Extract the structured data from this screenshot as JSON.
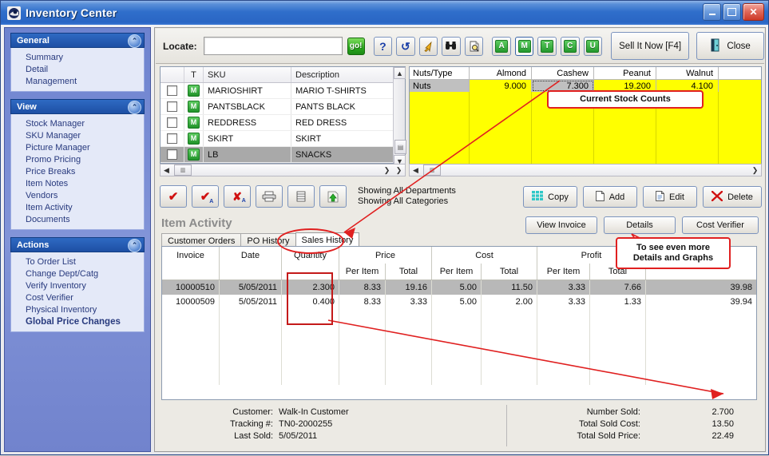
{
  "window": {
    "title": "Inventory Center",
    "minimize": "_",
    "maximize": "❐",
    "close": "✕"
  },
  "sidebar": {
    "groups": [
      {
        "title": "General",
        "collapse_icon": "chevron-up",
        "items": [
          {
            "label": "Summary",
            "bold": false
          },
          {
            "label": "Detail",
            "bold": false
          },
          {
            "label": "Management",
            "bold": false
          }
        ]
      },
      {
        "title": "View",
        "collapse_icon": "chevron-up",
        "items": [
          {
            "label": "Stock Manager",
            "bold": false
          },
          {
            "label": "SKU Manager",
            "bold": false
          },
          {
            "label": "Picture Manager",
            "bold": false
          },
          {
            "label": "Promo Pricing",
            "bold": false
          },
          {
            "label": "Price Breaks",
            "bold": false
          },
          {
            "label": "Item Notes",
            "bold": false
          },
          {
            "label": "Vendors",
            "bold": false
          },
          {
            "label": "Item Activity",
            "bold": false
          },
          {
            "label": "Documents",
            "bold": false
          }
        ]
      },
      {
        "title": "Actions",
        "collapse_icon": "chevron-up",
        "items": [
          {
            "label": "To Order List",
            "bold": false
          },
          {
            "label": "Change Dept/Catg",
            "bold": false
          },
          {
            "label": "Verify Inventory",
            "bold": false
          },
          {
            "label": "Cost Verifier",
            "bold": false
          },
          {
            "label": "Physical Inventory",
            "bold": false
          },
          {
            "label": "Global Price Changes",
            "bold": true
          }
        ]
      }
    ]
  },
  "toolbar": {
    "locate_label": "Locate:",
    "locate_value": "",
    "locate_placeholder": "",
    "go_label": "go!",
    "icon_buttons": [
      {
        "name": "help-icon",
        "glyph": "?"
      },
      {
        "name": "refresh-icon",
        "glyph": "↺"
      },
      {
        "name": "export-arrow-icon",
        "glyph": "↖"
      },
      {
        "name": "binoculars-icon",
        "glyph": "🔭"
      },
      {
        "name": "preview-icon",
        "glyph": "🔍"
      }
    ],
    "letter_buttons": [
      "A",
      "M",
      "T",
      "C",
      "U"
    ],
    "sell_now_label": "Sell It Now [F4]",
    "close_label": "Close",
    "close_icon": "exit-door-icon"
  },
  "item_grid": {
    "columns": [
      "",
      "T",
      "SKU",
      "Description"
    ],
    "rows": [
      {
        "checked": false,
        "type": "M",
        "sku": "MARIOSHIRT",
        "description": "MARIO T-SHIRTS",
        "selected": false
      },
      {
        "checked": false,
        "type": "M",
        "sku": "PANTSBLACK",
        "description": "PANTS BLACK",
        "selected": false
      },
      {
        "checked": false,
        "type": "M",
        "sku": "REDDRESS",
        "description": "RED DRESS",
        "selected": false
      },
      {
        "checked": false,
        "type": "M",
        "sku": "SKIRT",
        "description": "SKIRT",
        "selected": false
      },
      {
        "checked": false,
        "type": "M",
        "sku": "LB",
        "description": "SNACKS",
        "selected": true
      }
    ]
  },
  "stock_panel": {
    "columns": [
      "Nuts/Type",
      "Almond",
      "Cashew",
      "Peanut",
      "Walnut",
      ""
    ],
    "row_label": "Nuts",
    "values": [
      "9.000",
      "7.300",
      "19.200",
      "4.100",
      ""
    ],
    "selected_cell_index": 1
  },
  "mid_toolbar": {
    "mini_buttons": [
      {
        "name": "check-icon",
        "glyph": "✔"
      },
      {
        "name": "check-all-icon",
        "glyph": "✔"
      },
      {
        "name": "uncheck-all-icon",
        "glyph": "✘"
      },
      {
        "name": "print-icon",
        "glyph": "🖶"
      },
      {
        "name": "list-icon",
        "glyph": "▤"
      },
      {
        "name": "upload-icon",
        "glyph": "⬆"
      }
    ],
    "showing_line1": "Showing All Departments",
    "showing_line2": "Showing All Categories",
    "actions": [
      {
        "label": "Copy",
        "icon": "copy-grid-icon"
      },
      {
        "label": "Add",
        "icon": "page-add-icon"
      },
      {
        "label": "Edit",
        "icon": "page-edit-icon"
      },
      {
        "label": "Delete",
        "icon": "red-x-icon"
      }
    ]
  },
  "activity": {
    "title": "Item Activity",
    "tabs": [
      {
        "label": "Customer Orders",
        "selected": false
      },
      {
        "label": "PO History",
        "selected": false
      },
      {
        "label": "Sales History",
        "selected": true
      }
    ],
    "buttons": [
      {
        "label": "View Invoice"
      },
      {
        "label": "Details"
      },
      {
        "label": "Cost Verifier"
      }
    ]
  },
  "sales_table": {
    "group_headers": [
      "Invoice",
      "Date",
      "Quantity",
      "Price",
      "Cost",
      "Profit",
      ""
    ],
    "sub_headers": [
      "",
      "",
      "",
      "Per Item",
      "Total",
      "Per Item",
      "Total",
      "Per Item",
      "Total",
      ""
    ],
    "rows": [
      {
        "invoice": "10000510",
        "date": "5/05/2011",
        "quantity": "2.300",
        "price_per_item": "8.33",
        "price_total": "19.16",
        "cost_per_item": "5.00",
        "cost_total": "11.50",
        "profit_per_item": "3.33",
        "profit_total": "7.66",
        "last": "39.98",
        "selected": true
      },
      {
        "invoice": "10000509",
        "date": "5/05/2011",
        "quantity": "0.400",
        "price_per_item": "8.33",
        "price_total": "3.33",
        "cost_per_item": "5.00",
        "cost_total": "2.00",
        "profit_per_item": "3.33",
        "profit_total": "1.33",
        "last": "39.94",
        "selected": false
      }
    ]
  },
  "summary": {
    "left": [
      {
        "label": "Customer:",
        "value": "Walk-In Customer"
      },
      {
        "label": "Tracking #:",
        "value": "TN0-2000255"
      },
      {
        "label": "Last Sold:",
        "value": "5/05/2011"
      }
    ],
    "right": [
      {
        "label": "Number Sold:",
        "value": "2.700"
      },
      {
        "label": "Total Sold Cost:",
        "value": "13.50"
      },
      {
        "label": "Total Sold Price:",
        "value": "22.49"
      }
    ]
  },
  "annotations": {
    "stock_callout": "Current Stock Counts",
    "details_callout_line1": "To see even more",
    "details_callout_line2": "Details and Graphs",
    "accent_color": "#e02020"
  }
}
